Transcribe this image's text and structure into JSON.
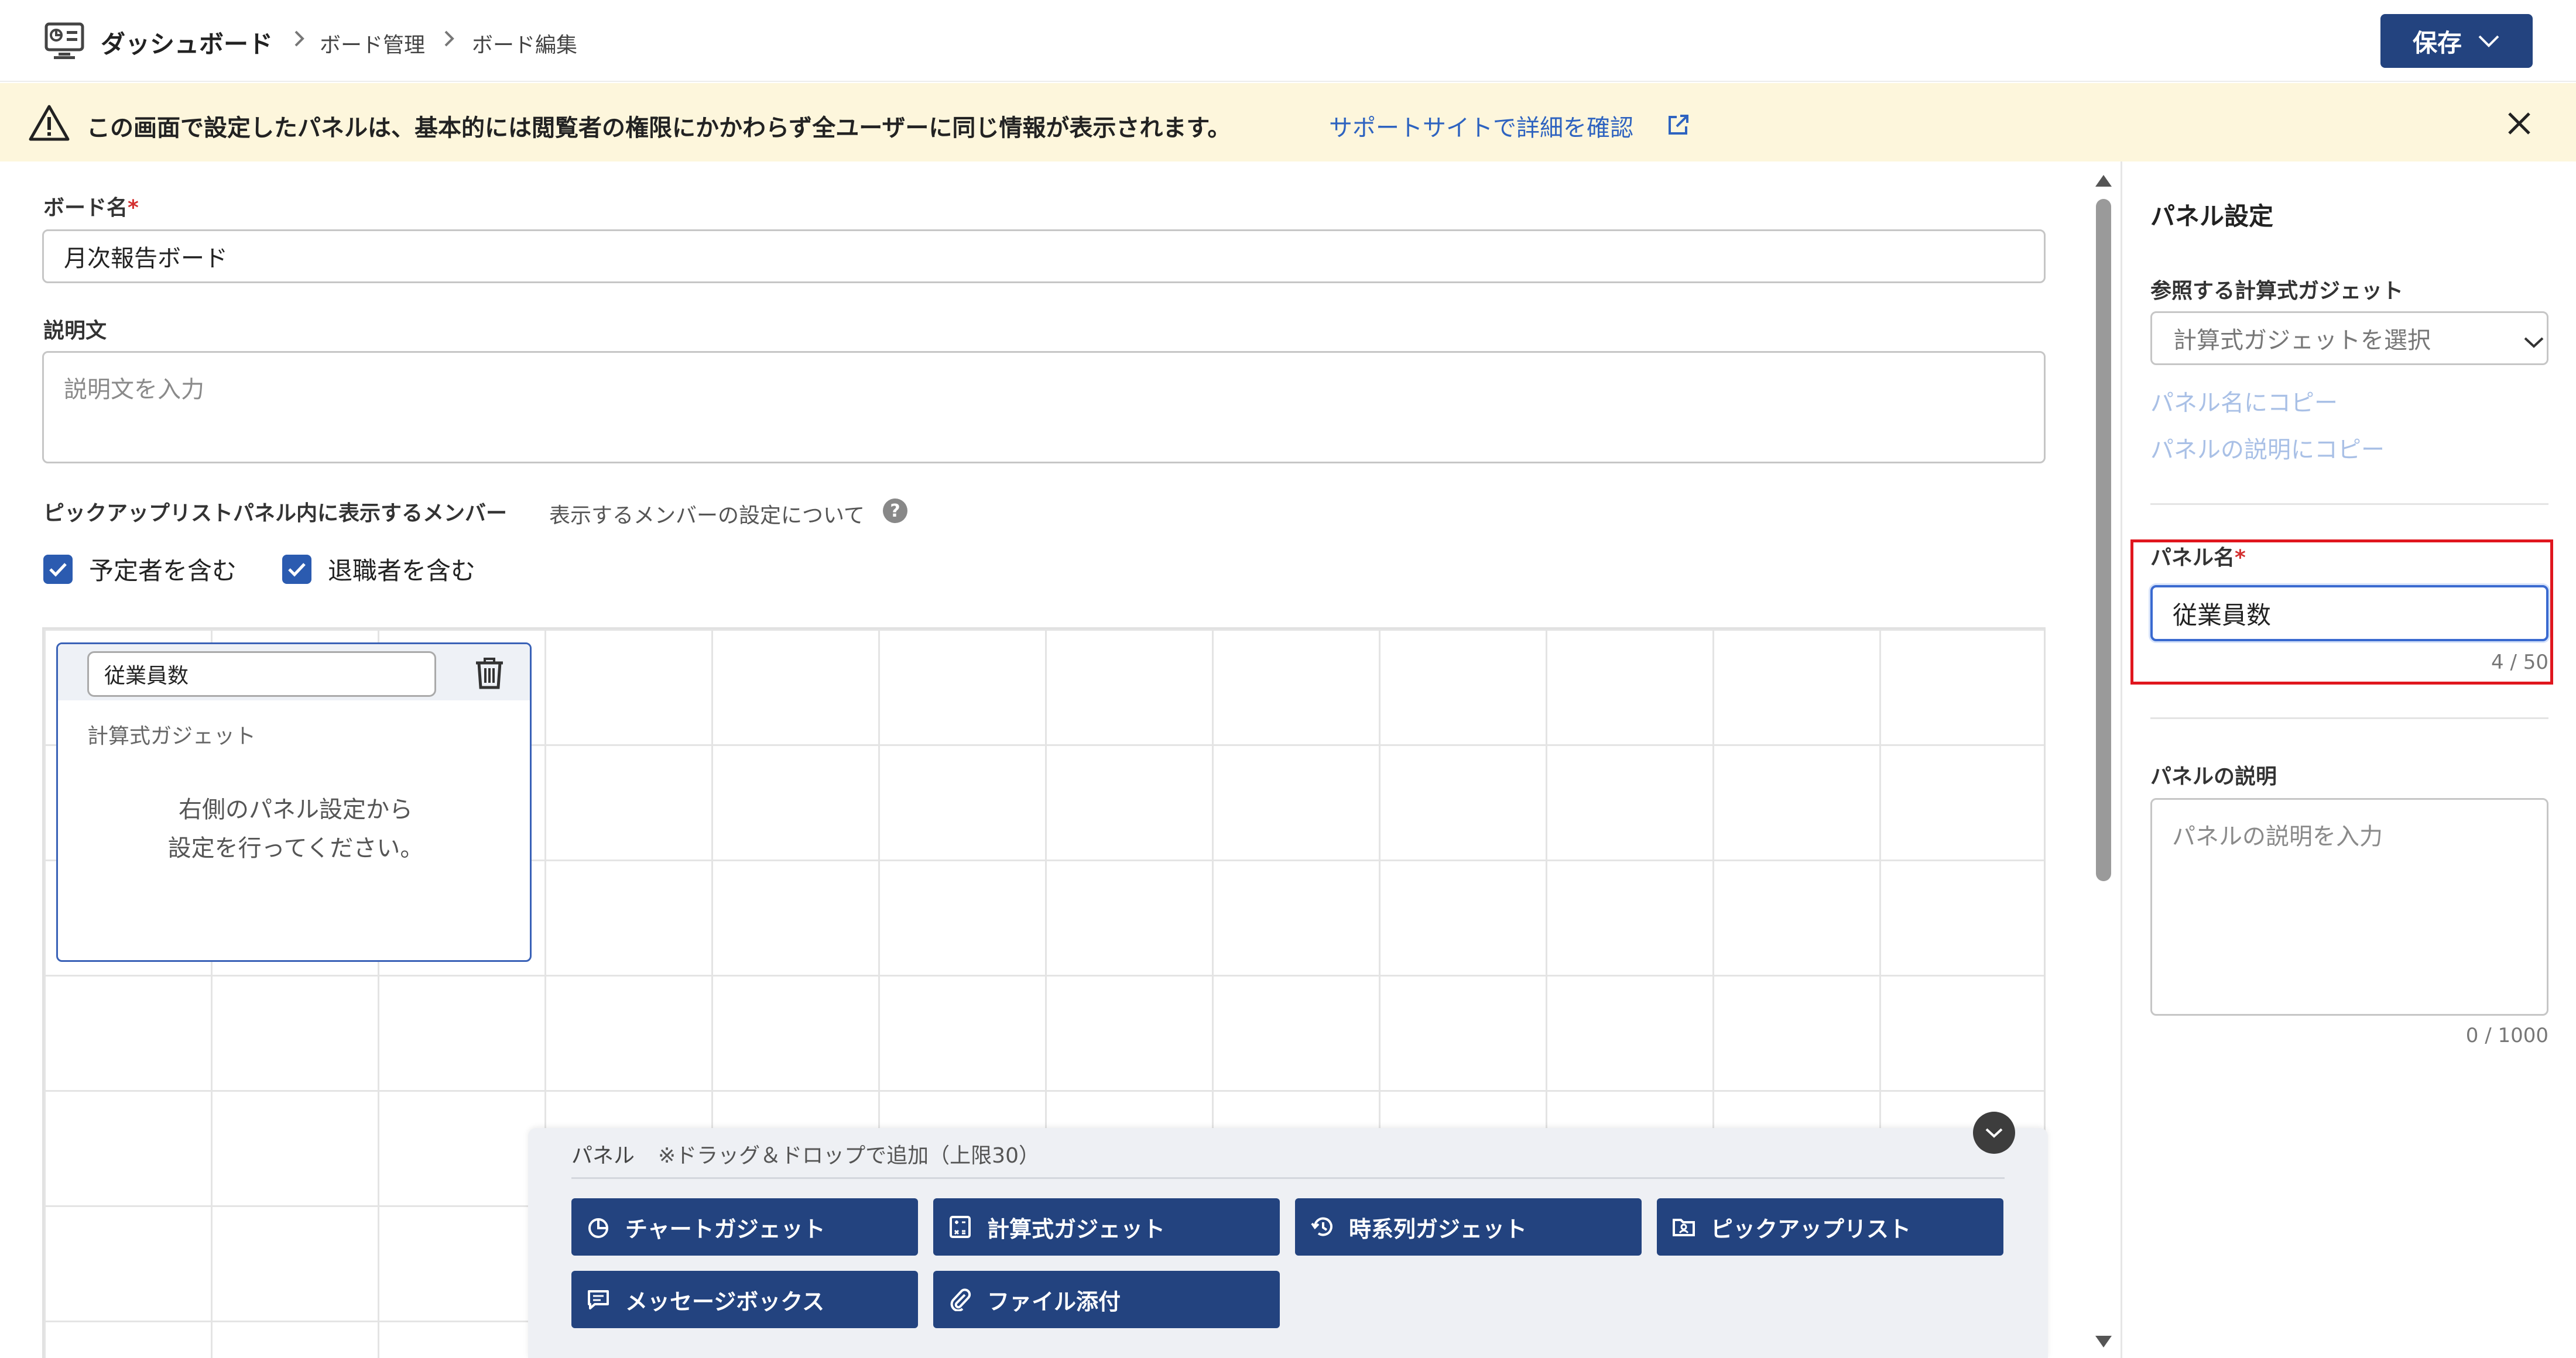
{
  "header": {
    "title": "ダッシュボード",
    "breadcrumbs": [
      "ボード管理",
      "ボード編集"
    ],
    "save_label": "保存"
  },
  "banner": {
    "message": "この画面で設定したパネルは、基本的には閲覧者の権限にかかわらず全ユーザーに同じ情報が表示されます。",
    "link_text": "サポートサイトで詳細を確認"
  },
  "form": {
    "board_name_label": "ボード名",
    "required_mark": "*",
    "board_name_value": "月次報告ボード",
    "description_label": "説明文",
    "description_placeholder": "説明文を入力",
    "members_label": "ピックアップリストパネル内に表示するメンバー",
    "members_help": "表示するメンバーの設定について",
    "help_icon_glyph": "?",
    "checkboxes": [
      {
        "label": "予定者を含む",
        "checked": true
      },
      {
        "label": "退職者を含む",
        "checked": true
      }
    ]
  },
  "panel_card": {
    "name": "従業員数",
    "type": "計算式ガジェット",
    "hint_line1": "右側のパネル設定から",
    "hint_line2": "設定を行ってください。"
  },
  "palette": {
    "title": "パネル",
    "note": "※ドラッグ＆ドロップで追加（上限30）",
    "buttons": [
      {
        "label": "チャートガジェット",
        "icon": "chart-icon"
      },
      {
        "label": "計算式ガジェット",
        "icon": "calculator-icon"
      },
      {
        "label": "時系列ガジェット",
        "icon": "history-icon"
      },
      {
        "label": "ピックアップリスト",
        "icon": "folder-person-icon"
      },
      {
        "label": "メッセージボックス",
        "icon": "message-icon"
      },
      {
        "label": "ファイル添付",
        "icon": "paperclip-icon"
      }
    ]
  },
  "right_panel": {
    "title": "パネル設定",
    "gadget_label": "参照する計算式ガジェット",
    "gadget_placeholder": "計算式ガジェットを選択",
    "copy_to_name": "パネル名にコピー",
    "copy_to_desc": "パネルの説明にコピー",
    "name_label": "パネル名",
    "name_value": "従業員数",
    "name_count": "4 / 50",
    "desc_label": "パネルの説明",
    "desc_placeholder": "パネルの説明を入力",
    "desc_count": "0 / 1000"
  },
  "colors": {
    "primary": "#23437f",
    "link": "#2e63c0",
    "banner_bg": "#fdf6dc",
    "highlight": "#e0161e",
    "checkbox": "#2b5bb0"
  }
}
